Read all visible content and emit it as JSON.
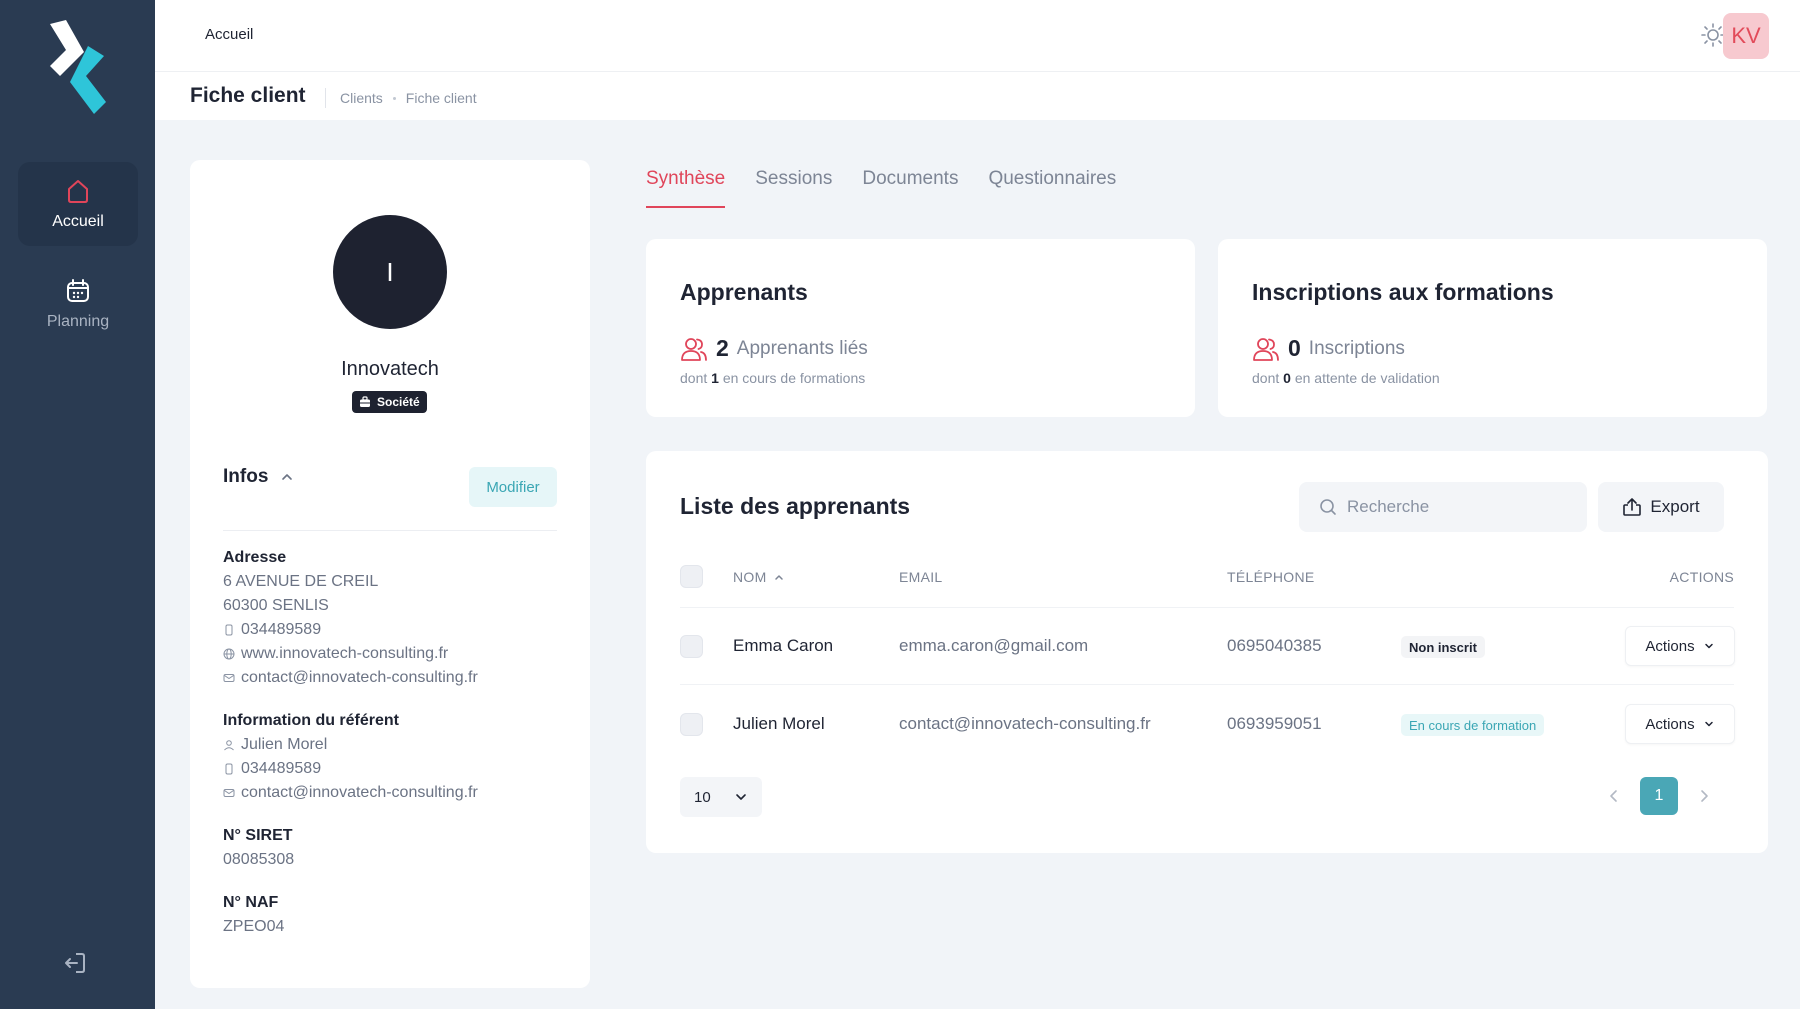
{
  "sidebar": {
    "items": [
      {
        "label": "Accueil",
        "icon": "home-icon",
        "active": true
      },
      {
        "label": "Planning",
        "icon": "calendar-icon",
        "active": false
      }
    ],
    "logout_icon": "logout-icon"
  },
  "header": {
    "title": "Accueil",
    "theme_icon": "sun-icon",
    "avatar_initials": "KV"
  },
  "subheader": {
    "page_title": "Fiche client",
    "breadcrumb": [
      "Clients",
      "Fiche client"
    ]
  },
  "client": {
    "initial": "I",
    "name": "Innovatech",
    "type_badge": "Société",
    "infos_title": "Infos",
    "modify_label": "Modifier",
    "address_label": "Adresse",
    "address_line1": "6 AVENUE DE CREIL",
    "address_line2": "60300 SENLIS",
    "phone": "034489589",
    "website": "www.innovatech-consulting.fr",
    "email": "contact@innovatech-consulting.fr",
    "referent_label": "Information du référent",
    "referent_name": "Julien Morel",
    "referent_phone": "034489589",
    "referent_email": "contact@innovatech-consulting.fr",
    "siret_label": "N° SIRET",
    "siret": "08085308",
    "naf_label": "N° NAF",
    "naf": "ZPEO04"
  },
  "tabs": [
    {
      "label": "Synthèse",
      "active": true
    },
    {
      "label": "Sessions",
      "active": false
    },
    {
      "label": "Documents",
      "active": false
    },
    {
      "label": "Questionnaires",
      "active": false
    }
  ],
  "stats": {
    "apprenants": {
      "title": "Apprenants",
      "count": "2",
      "unit": "Apprenants liés",
      "sub_prefix": "dont",
      "sub_count": "1",
      "sub_suffix": "en cours de formations"
    },
    "inscriptions": {
      "title": "Inscriptions aux formations",
      "count": "0",
      "unit": "Inscriptions",
      "sub_prefix": "dont",
      "sub_count": "0",
      "sub_suffix": "en attente de validation"
    }
  },
  "list": {
    "title": "Liste des apprenants",
    "search_placeholder": "Recherche",
    "export_label": "Export",
    "columns": {
      "name": "NOM",
      "email": "EMAIL",
      "phone": "TÉLÉPHONE",
      "actions": "ACTIONS"
    },
    "rows": [
      {
        "name": "Emma Caron",
        "email": "emma.caron@gmail.com",
        "phone": "0695040385",
        "status": "Non inscrit",
        "status_color": "#1f2433",
        "action": "Actions"
      },
      {
        "name": "Julien Morel",
        "email": "contact@innovatech-consulting.fr",
        "phone": "0693959051",
        "status": "En cours de formation",
        "status_color": "#3aa6b4",
        "action": "Actions"
      }
    ],
    "page_size": "10",
    "current_page": "1"
  },
  "colors": {
    "accent": "#e0455a",
    "teal": "#4aa7b6",
    "sidebar": "#2a3b52"
  }
}
